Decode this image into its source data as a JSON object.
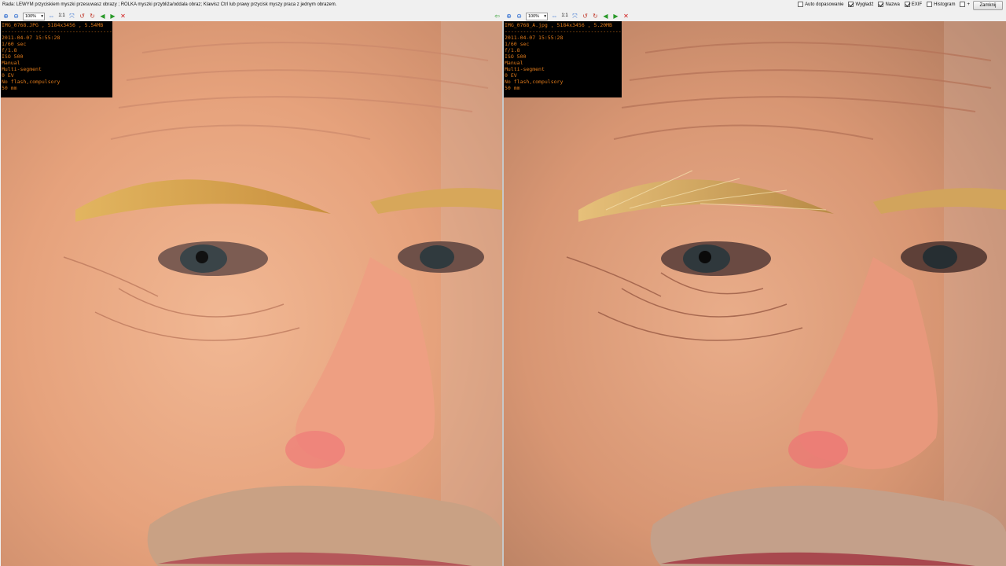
{
  "hint": "Rada: LEWYM przyciskiem myszki przesuwasz obrazy ; ROLKA myszki przybliża/oddala obraz; Klawisz Ctrl lub prawy przycisk myszy praca z jednym obrazem.",
  "options": [
    {
      "label": "Auto dopasowanie",
      "checked": false
    },
    {
      "label": "Wygładź",
      "checked": true
    },
    {
      "label": "Nazwa",
      "checked": true
    },
    {
      "label": "EXIF",
      "checked": true
    },
    {
      "label": "Histogram",
      "checked": false
    },
    {
      "label": "+",
      "checked": false
    }
  ],
  "close_label": "Zamknij",
  "toolbar": {
    "left_zoom": "100%",
    "right_zoom": "100%",
    "one_to_one": "1:1"
  },
  "left_image": {
    "name_line": "IMG_0768.JPG , 5184x3456 , 5.54MB",
    "separator": "------------------------------------------------",
    "exif": [
      "2011-04-07 15:55:28",
      "1/60 sec",
      "f/1.8",
      "ISO 500",
      "Manual",
      "Multi-segment",
      "0 EV",
      "No flash,compulsory",
      "50 mm"
    ]
  },
  "right_image": {
    "name_line": "IMG_0768_A.jpg , 5184x3456 , 5.20MB",
    "separator": "------------------------------------------------",
    "exif": [
      "2011-04-07 15:55:28",
      "1/60 sec",
      "f/1.8",
      "ISO 500",
      "Manual",
      "Multi-segment",
      "0 EV",
      "No flash,compulsory",
      "50 mm"
    ]
  },
  "colors": {
    "exif_text": "#e07a1a",
    "skin": "#e8a57f",
    "brow": "#d9a24a"
  }
}
